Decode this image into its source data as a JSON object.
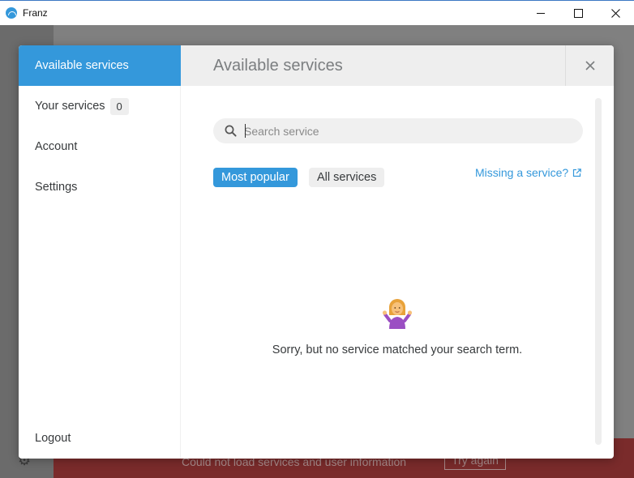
{
  "window": {
    "title": "Franz"
  },
  "background": {
    "error_message": "Could not load services and user information",
    "retry_label": "Try again"
  },
  "sidebar": {
    "items": [
      {
        "label": "Available services",
        "active": true
      },
      {
        "label": "Your services",
        "badge": "0"
      },
      {
        "label": "Account"
      },
      {
        "label": "Settings"
      }
    ],
    "logout_label": "Logout"
  },
  "header": {
    "title": "Available services"
  },
  "search": {
    "placeholder": "Search service",
    "value": ""
  },
  "filters": {
    "most_popular": "Most popular",
    "all_services": "All services"
  },
  "missing_link": "Missing a service?",
  "empty_state": {
    "message": "Sorry, but no service matched your search term."
  },
  "colors": {
    "accent": "#3498db",
    "header_bg": "#eeeeee",
    "error_bg": "#7a2b2b"
  },
  "icons": {
    "app": "franz-logo-icon",
    "search": "search-icon",
    "close": "close-icon",
    "external": "external-link-icon",
    "empty": "shrugging-person-icon"
  }
}
